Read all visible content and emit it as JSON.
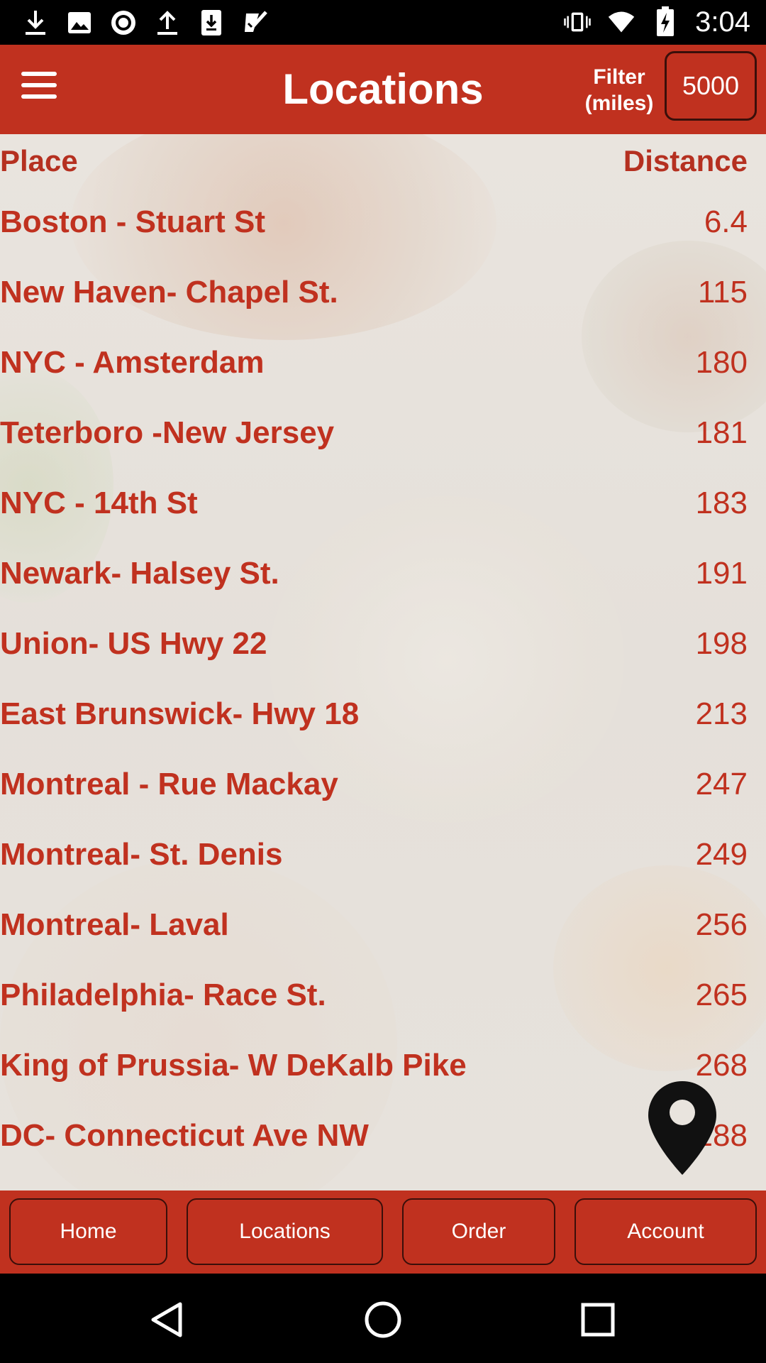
{
  "status_bar": {
    "time": "3:04",
    "left_icons": [
      "download-icon",
      "image-icon",
      "record-icon",
      "upload-icon",
      "download-box-icon",
      "check-box-icon"
    ],
    "right_icons": [
      "vibrate-icon",
      "wifi-icon",
      "battery-charging-icon"
    ]
  },
  "app_bar": {
    "title": "Locations",
    "filter_label_line1": "Filter",
    "filter_label_line2": "(miles)",
    "filter_value": "5000"
  },
  "list": {
    "header_place": "Place",
    "header_distance": "Distance",
    "rows": [
      {
        "name": "Boston - Stuart St",
        "distance": "6.4"
      },
      {
        "name": "New Haven- Chapel St.",
        "distance": "115"
      },
      {
        "name": "NYC - Amsterdam",
        "distance": "180"
      },
      {
        "name": "Teterboro -New Jersey",
        "distance": "181"
      },
      {
        "name": "NYC - 14th St",
        "distance": "183"
      },
      {
        "name": "Newark- Halsey St.",
        "distance": "191"
      },
      {
        "name": "Union- US Hwy 22",
        "distance": "198"
      },
      {
        "name": "East Brunswick- Hwy 18",
        "distance": "213"
      },
      {
        "name": "Montreal - Rue Mackay",
        "distance": "247"
      },
      {
        "name": "Montreal- St. Denis",
        "distance": "249"
      },
      {
        "name": "Montreal- Laval",
        "distance": "256"
      },
      {
        "name": "Philadelphia- Race St.",
        "distance": "265"
      },
      {
        "name": "King of Prussia- W DeKalb Pike",
        "distance": "268"
      },
      {
        "name": "DC- Connecticut Ave NW",
        "distance": "288"
      }
    ]
  },
  "bottom_nav": {
    "home": "Home",
    "locations": "Locations",
    "order": "Order",
    "account": "Account"
  },
  "colors": {
    "brand_red": "#c0311f",
    "text_red": "#c0311f",
    "border_dark": "#3a0f0a"
  }
}
